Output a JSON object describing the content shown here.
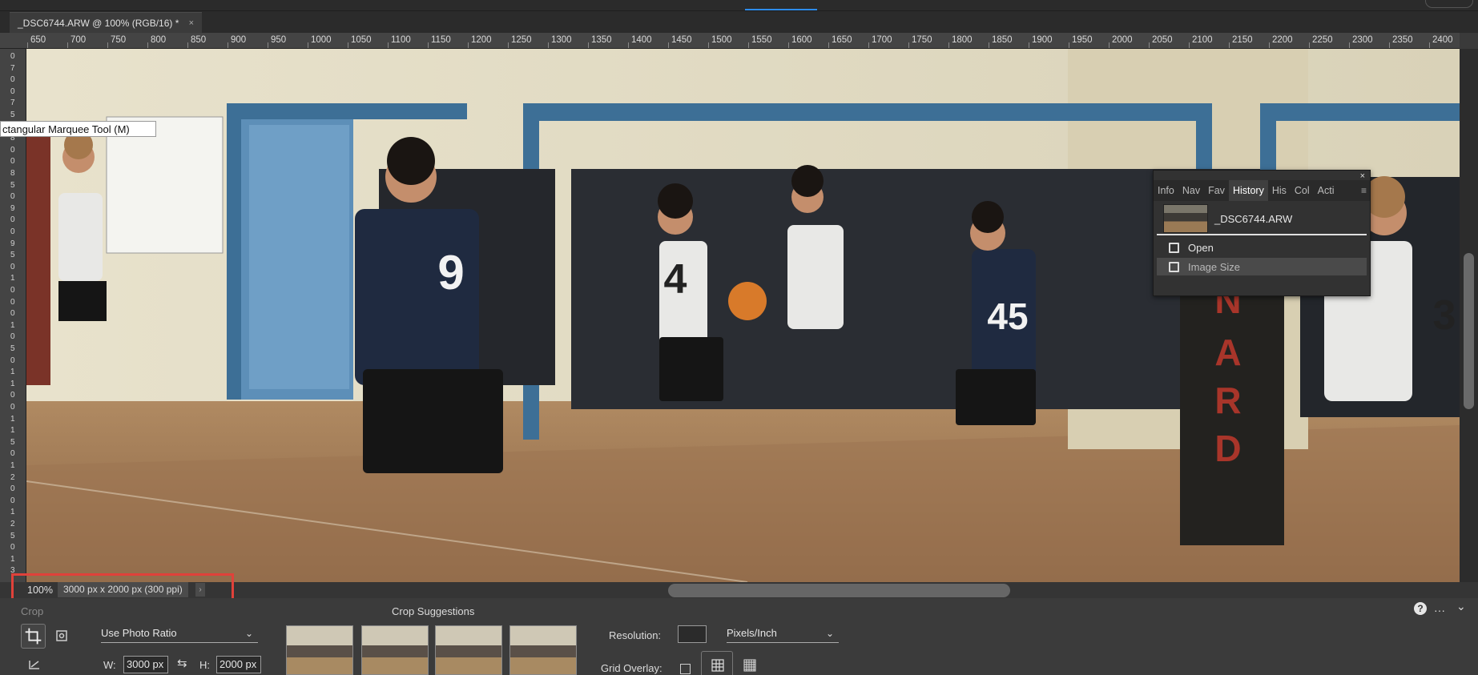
{
  "document_tab": {
    "title": "_DSC6744.ARW @ 100% (RGB/16) *",
    "close_glyph": "×"
  },
  "ruler": {
    "horizontal_labels": [
      "650",
      "700",
      "750",
      "800",
      "850",
      "900",
      "950",
      "1000",
      "1050",
      "1100",
      "1150",
      "1200",
      "1250",
      "1300",
      "1350",
      "1400",
      "1450",
      "1500",
      "1550",
      "1600",
      "1650",
      "1700",
      "1750",
      "1800",
      "1850",
      "1900",
      "1950",
      "2000",
      "2050",
      "2100",
      "2150",
      "2200",
      "2250",
      "2300",
      "2350",
      "2400"
    ],
    "vertical_digits": [
      "0",
      "7",
      "0",
      "0",
      "7",
      "5",
      "0",
      "8",
      "0",
      "0",
      "8",
      "5",
      "0",
      "9",
      "0",
      "0",
      "9",
      "5",
      "0",
      "1",
      "0",
      "0",
      "0",
      "1",
      "0",
      "5",
      "0",
      "1",
      "1",
      "0",
      "0",
      "1",
      "1",
      "5",
      "0",
      "1",
      "2",
      "0",
      "0",
      "1",
      "2",
      "5",
      "0",
      "1",
      "3"
    ]
  },
  "tooltip": {
    "text": "ctangular Marquee Tool (M)"
  },
  "history_panel": {
    "close_glyph": "×",
    "tabs": [
      "Info",
      "Nav",
      "Fav",
      "History",
      "His",
      "Col",
      "Acti"
    ],
    "active_tab": "History",
    "menu_glyph": "≡",
    "snapshot": {
      "label": "_DSC6744.ARW"
    },
    "items": [
      {
        "label": "Open",
        "selected": false
      },
      {
        "label": "Image Size",
        "selected": true
      }
    ]
  },
  "status": {
    "zoom": "100%",
    "doc_info": "3000 px x 2000 px (300 ppi)",
    "arrow": "›"
  },
  "options_bar": {
    "tool_title": "Crop",
    "ratio_dropdown": "Use Photo Ratio",
    "width_label": "W:",
    "width_value": "3000 px",
    "height_label": "H:",
    "height_value": "2000 px",
    "suggestions_title": "Crop Suggestions",
    "resolution_label": "Resolution:",
    "resolution_value": "",
    "resolution_unit": "Pixels/Inch",
    "grid_overlay_label": "Grid Overlay:",
    "help_glyph": "?",
    "more_glyph": "···",
    "collapse_glyph": "⌄"
  },
  "colors": {
    "accent": "#2d8ceb",
    "highlight_box": "#e0413a",
    "panel_bg": "#323232"
  }
}
